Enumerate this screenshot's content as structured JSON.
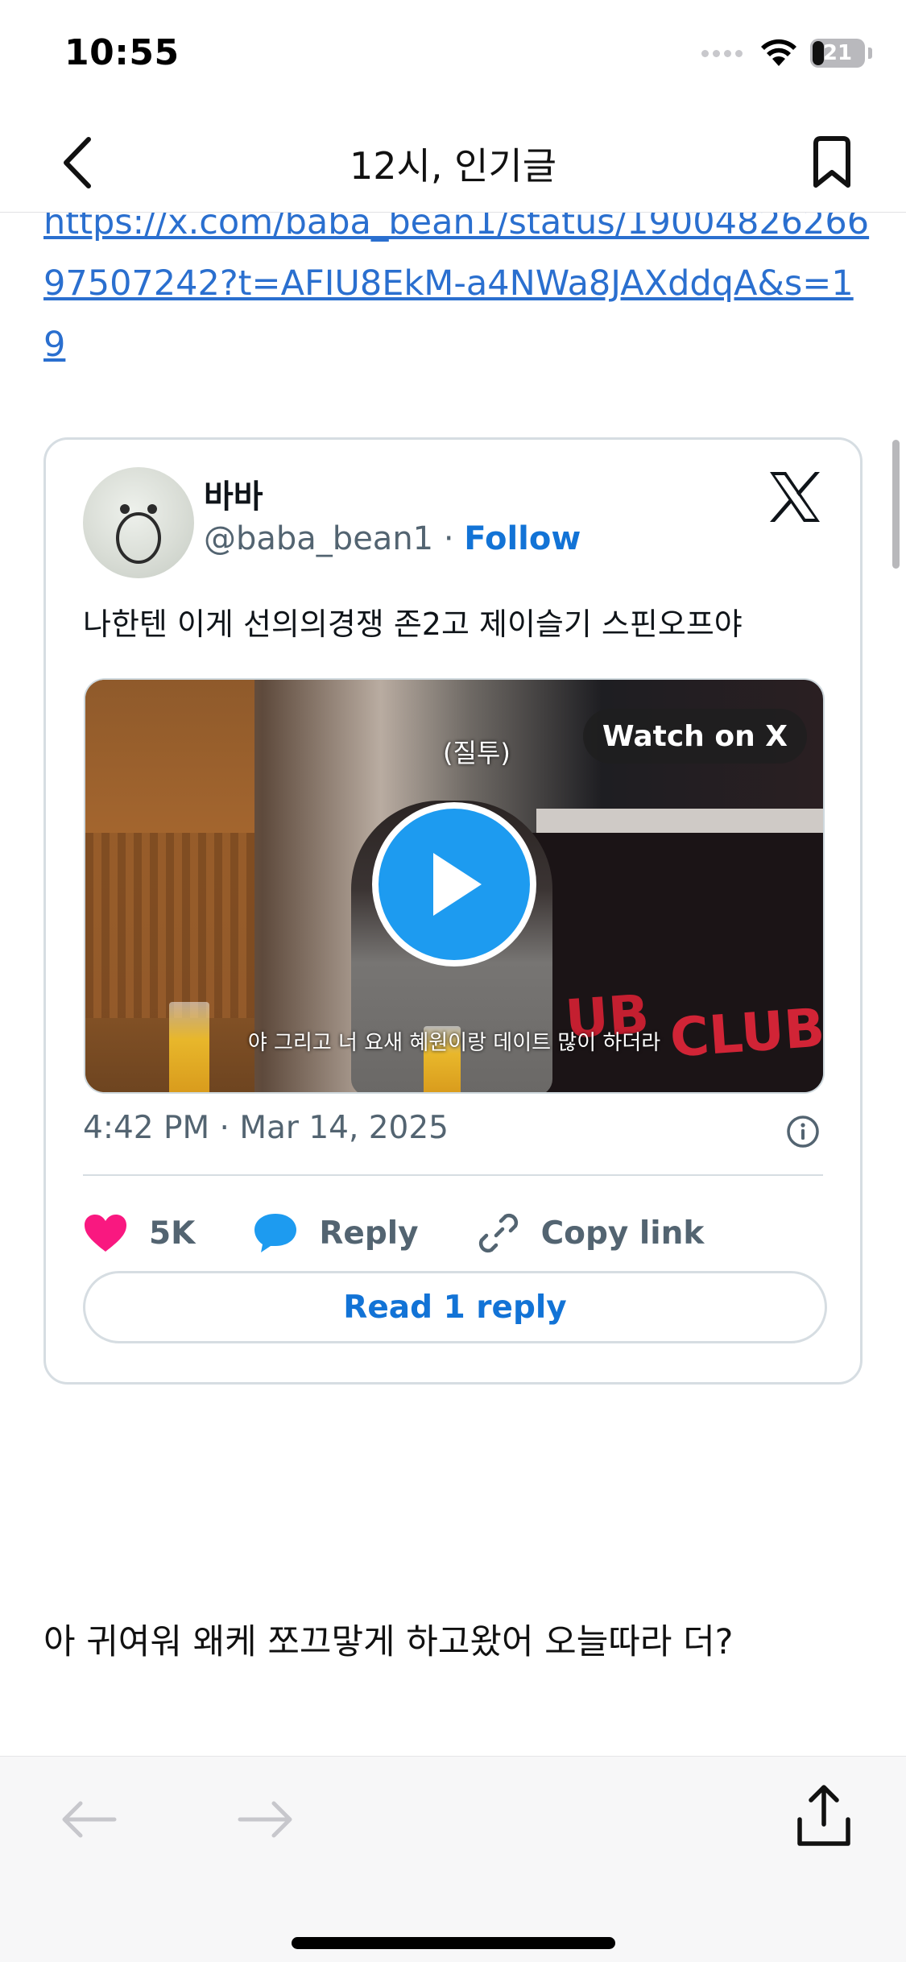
{
  "status_bar": {
    "time": "10:55",
    "battery_level": "21",
    "battery_fraction": 0.21,
    "signal_icon": "cellular-dots-icon",
    "wifi_icon": "wifi-icon"
  },
  "nav": {
    "title": "12시, 인기글",
    "back_icon": "chevron-left-icon",
    "bookmark_icon": "bookmark-icon"
  },
  "post": {
    "link_url": "https://x.com/baba_bean1/status/1900482626697507242?t=AFIU8EkM-a4NWa8JAXddqA&s=19",
    "body_text": "아 귀여워 왜케 쪼끄맣게 하고왔어 오늘따라 더?"
  },
  "tweet": {
    "author_name": "바바",
    "handle": "@baba_bean1",
    "separator": " · ",
    "follow_label": "Follow",
    "text": "나한텐 이게 선의의경쟁 존2고 제이슬기 스핀오프야",
    "video": {
      "watch_label": "Watch on X",
      "caption_top": "(질투)",
      "subtitle": "야 그리고 너 요새 혜원이랑 데이트 많이 하더라",
      "sign_text_1": "UB",
      "sign_text_2": "CLUB"
    },
    "timestamp": "4:42 PM · Mar 14, 2025",
    "likes": "5K",
    "reply_label": "Reply",
    "copy_link_label": "Copy link",
    "read_reply_label": "Read 1 reply"
  },
  "colors": {
    "link_blue": "#2a6fcf",
    "x_blue": "#1273d6",
    "play_blue": "#1d9bf0",
    "like_pink": "#f91880",
    "muted_gray": "#536471"
  },
  "toolbar": {
    "back_icon": "arrow-left-icon",
    "forward_icon": "arrow-right-icon",
    "share_icon": "share-icon"
  }
}
